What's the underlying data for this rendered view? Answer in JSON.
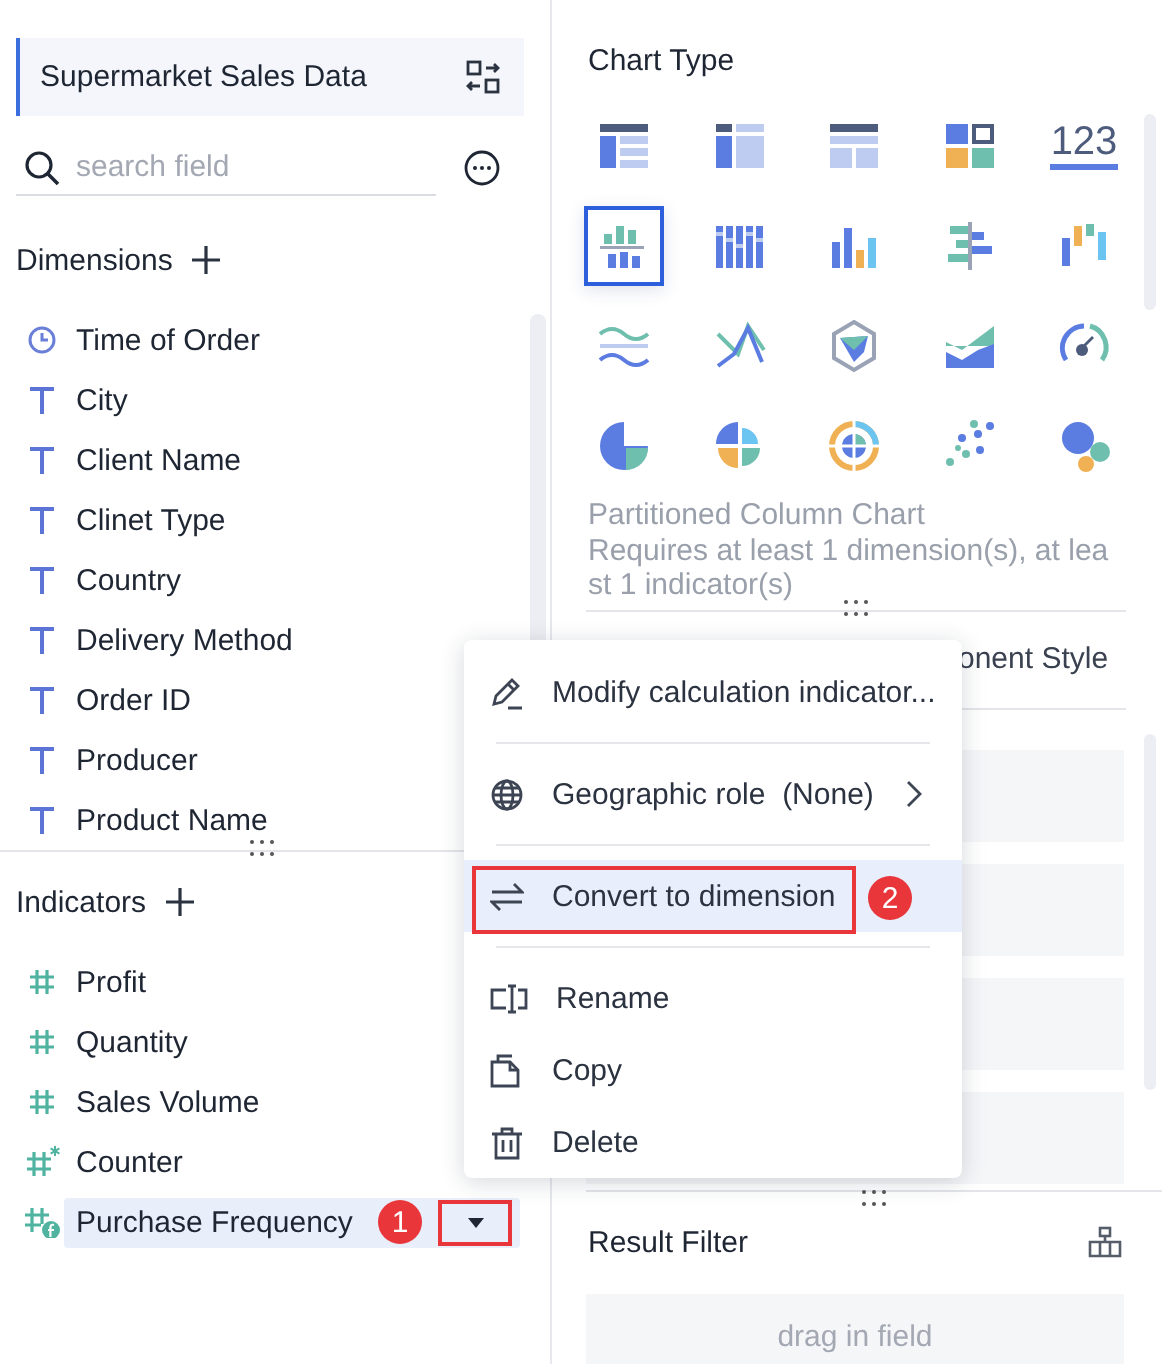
{
  "dataset": {
    "title": "Supermarket Sales Data"
  },
  "search": {
    "placeholder": "search field"
  },
  "dimensions": {
    "title": "Dimensions",
    "items": [
      {
        "label": "Time of Order",
        "kind": "date"
      },
      {
        "label": "City",
        "kind": "text"
      },
      {
        "label": "Client Name",
        "kind": "text"
      },
      {
        "label": "Clinet Type",
        "kind": "text"
      },
      {
        "label": "Country",
        "kind": "text"
      },
      {
        "label": "Delivery Method",
        "kind": "text"
      },
      {
        "label": "Order ID",
        "kind": "text"
      },
      {
        "label": "Producer",
        "kind": "text"
      },
      {
        "label": "Product Name",
        "kind": "text"
      }
    ]
  },
  "indicators": {
    "title": "Indicators",
    "items": [
      {
        "label": "Profit",
        "kind": "number",
        "selected": false
      },
      {
        "label": "Quantity",
        "kind": "number",
        "selected": false
      },
      {
        "label": "Sales Volume",
        "kind": "number",
        "selected": false
      },
      {
        "label": "Counter",
        "kind": "count",
        "selected": false
      },
      {
        "label": "Purchase Frequency",
        "kind": "calculated",
        "selected": true,
        "callout": "1"
      }
    ]
  },
  "chart_panel": {
    "title": "Chart Type",
    "chart_types": [
      {
        "kind": "detail-table",
        "selected": false
      },
      {
        "kind": "pivot-table",
        "selected": false
      },
      {
        "kind": "cross-table",
        "selected": false
      },
      {
        "kind": "card-grid",
        "selected": false
      },
      {
        "kind": "number",
        "glyph": "123",
        "selected": false
      },
      {
        "kind": "partitioned-column",
        "selected": true
      },
      {
        "kind": "stacked-column",
        "selected": false
      },
      {
        "kind": "column",
        "selected": false
      },
      {
        "kind": "bidirectional-bar",
        "selected": false
      },
      {
        "kind": "waterfall",
        "selected": false
      },
      {
        "kind": "wave-band",
        "selected": false
      },
      {
        "kind": "line",
        "selected": false
      },
      {
        "kind": "radar",
        "selected": false
      },
      {
        "kind": "area",
        "selected": false
      },
      {
        "kind": "gauge",
        "selected": false
      },
      {
        "kind": "pie",
        "selected": false
      },
      {
        "kind": "rose",
        "selected": false
      },
      {
        "kind": "sunburst",
        "selected": false
      },
      {
        "kind": "scatter",
        "selected": false
      },
      {
        "kind": "bubble",
        "selected": false
      }
    ],
    "caption_title": "Partitioned Column Chart",
    "caption_text": "Requires at least 1 dimension(s), at least 1 indicator(s)"
  },
  "style_tab": {
    "label": "onent Style"
  },
  "result_filter": {
    "title": "Result Filter",
    "drop_zone": "drag in field"
  },
  "context_menu": {
    "items": [
      {
        "label": "Modify calculation indicator...",
        "submenu": false,
        "selected": false,
        "divider_after": true
      },
      {
        "label": "Geographic role  (None)",
        "submenu": true,
        "selected": false,
        "divider_after": true
      },
      {
        "label": "Convert to dimension",
        "submenu": false,
        "selected": true,
        "divider_after": true,
        "callout": "2"
      },
      {
        "label": "Rename",
        "submenu": false,
        "selected": false,
        "divider_after": false
      },
      {
        "label": "Copy",
        "submenu": false,
        "selected": false,
        "divider_after": false
      },
      {
        "label": "Delete",
        "submenu": false,
        "selected": false,
        "divider_after": false
      }
    ]
  }
}
